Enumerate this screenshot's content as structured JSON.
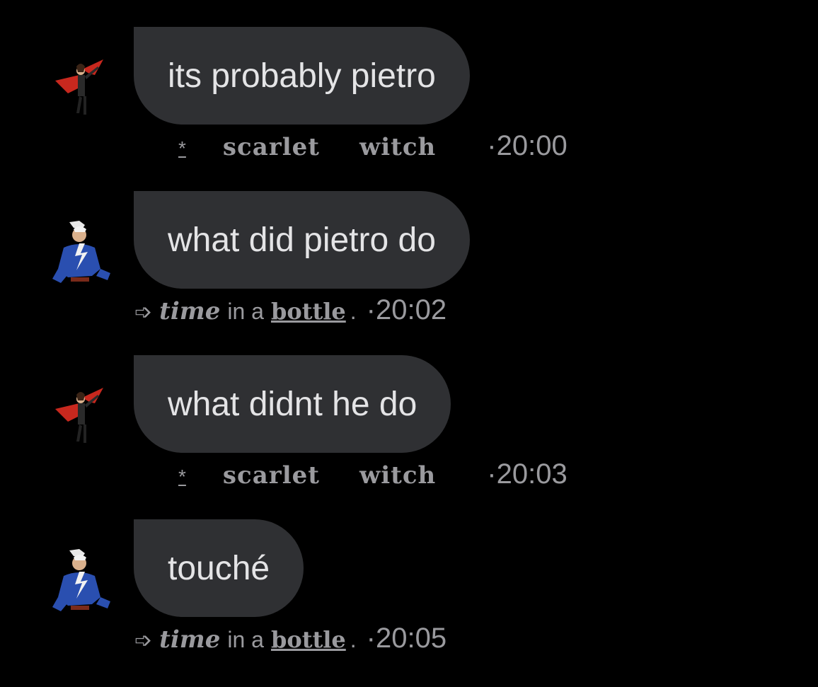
{
  "messages": [
    {
      "text": "its probably pietro",
      "sender": "scarlet_witch",
      "meta": {
        "prefix": "*",
        "name_a": "scarlet",
        "name_b": "witch",
        "time": "20:00"
      }
    },
    {
      "text": "what did pietro do",
      "sender": "pietro",
      "meta": {
        "arrow": "➩",
        "name_a": "time",
        "name_mid": "in a",
        "name_b": "bottle",
        "suffix": ".",
        "time": "20:02"
      }
    },
    {
      "text": "what didnt he do",
      "sender": "scarlet_witch",
      "meta": {
        "prefix": "*",
        "name_a": "scarlet",
        "name_b": "witch",
        "time": "20:03"
      }
    },
    {
      "text": "touché",
      "sender": "pietro",
      "meta": {
        "arrow": "➩",
        "name_a": "time",
        "name_mid": "in a",
        "name_b": "bottle",
        "suffix": ".",
        "time": "20:05"
      }
    }
  ],
  "separator": "·",
  "colors": {
    "background": "#000000",
    "bubble": "#2f3033",
    "bubble_text": "#e4e4e6",
    "meta_text": "#9a9a9e",
    "scarlet_cape": "#c8281e",
    "pietro_suit": "#2a4fb0"
  }
}
